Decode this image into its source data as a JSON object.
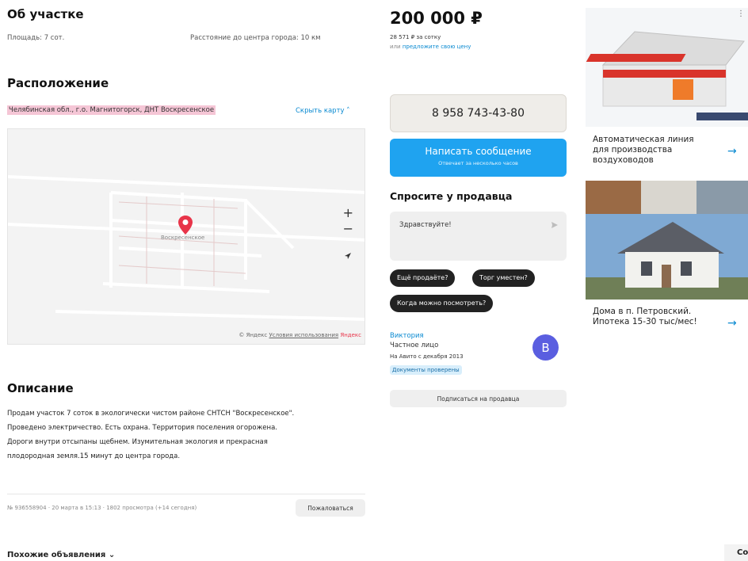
{
  "plot": {
    "heading": "Об участке",
    "area": "Площадь: 7 сот.",
    "distance": "Расстояние до центра города: 10 км"
  },
  "location": {
    "heading": "Расположение",
    "address": "Челябинская обл., г.о. Магнитогорск, ДНТ Воскресенское",
    "hide_map": "Скрыть карту ˄",
    "map_place_label": "Воскресенское",
    "map_zoom_in": "+",
    "map_zoom_out": "−",
    "map_copyright": "© Яндекс",
    "map_terms": "Условия использования",
    "map_brand": "Яндекс"
  },
  "description": {
    "heading": "Описание",
    "lines": [
      "Продам участок 7 соток в экологически чистом районе СНТСН \"Воскресенское\".",
      "Проведено электричество. Есть охрана. Территория поселения огорожена.",
      "Дороги внутри отсыпаны щебнем. Изумительная экология и прекрасная",
      "плодородная земля.15 минут до центра города."
    ]
  },
  "listing_meta": {
    "info": "№ 936558904 · 20 марта в 15:13 · 1802 просмотра (+14 сегодня)",
    "complain": "Пожаловаться"
  },
  "similar": {
    "heading": "Похожие объявления ⌄",
    "cut_label": "Со"
  },
  "price": {
    "value": "200 000 ₽",
    "per_unit": "28 571 ₽ за сотку",
    "offer_prefix": "или ",
    "offer_link": "предложите свою цену"
  },
  "contact": {
    "phone": "8 958 743-43-80",
    "message_button": "Написать сообщение",
    "message_sub": "Отвечает за несколько часов"
  },
  "ask": {
    "heading": "Спросите у продавца",
    "input_value": "Здравствуйте!",
    "chips": [
      "Ещё продаёте?",
      "Торг уместен?",
      "Когда можно посмотреть?"
    ]
  },
  "seller": {
    "name": "Виктория",
    "type": "Частное лицо",
    "since": "На Авито с декабря 2013",
    "verified": "Документы проверены",
    "avatar_letter": "B",
    "subscribe": "Подписаться на продавца"
  },
  "ads": [
    {
      "text": "Автоматическая линия для производства воздуховодов",
      "arrow": "→"
    },
    {
      "text": "Дома в п. Петровский. Ипотека 15-30 тыс/мес!",
      "arrow": "→"
    }
  ],
  "icons": {
    "map_pin": "map-pin-icon",
    "send": "send-icon",
    "locate": "locate-arrow-icon"
  },
  "colors": {
    "accent": "#1fa3f0",
    "link": "#0a8ad1",
    "address_highlight": "#f5c6d6",
    "pin": "#e8354a",
    "avatar": "#5a5ee0"
  }
}
